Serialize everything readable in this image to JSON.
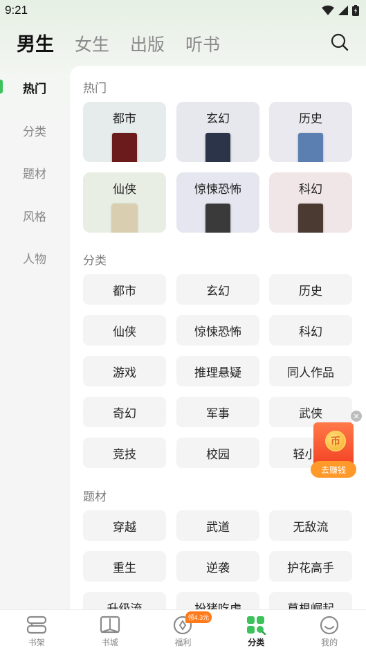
{
  "status_bar": {
    "time": "9:21"
  },
  "top_tabs": [
    {
      "label": "男生",
      "active": true
    },
    {
      "label": "女生",
      "active": false
    },
    {
      "label": "出版",
      "active": false
    },
    {
      "label": "听书",
      "active": false
    }
  ],
  "side_nav": [
    {
      "label": "热门",
      "active": true
    },
    {
      "label": "分类",
      "active": false
    },
    {
      "label": "题材",
      "active": false
    },
    {
      "label": "风格",
      "active": false
    },
    {
      "label": "人物",
      "active": false
    }
  ],
  "sections": {
    "hot": {
      "title": "热门",
      "cards": [
        {
          "label": "都市",
          "bg": "#e6ecec",
          "cover": "#6b1b1b"
        },
        {
          "label": "玄幻",
          "bg": "#e6e8ee",
          "cover": "#2b3448"
        },
        {
          "label": "历史",
          "bg": "#ebe9f0",
          "cover": "#5a7fb0"
        },
        {
          "label": "仙侠",
          "bg": "#e8eee3",
          "cover": "#d9cfb0"
        },
        {
          "label": "惊悚恐怖",
          "bg": "#e5e6f0",
          "cover": "#3a3a3a"
        },
        {
          "label": "科幻",
          "bg": "#f0e6e8",
          "cover": "#4a3a32"
        }
      ]
    },
    "category": {
      "title": "分类",
      "tags": [
        "都市",
        "玄幻",
        "历史",
        "仙侠",
        "惊悚恐怖",
        "科幻",
        "游戏",
        "推理悬疑",
        "同人作品",
        "奇幻",
        "军事",
        "武侠",
        "竞技",
        "校园",
        "轻小说"
      ]
    },
    "theme": {
      "title": "题材",
      "tags": [
        "穿越",
        "武道",
        "无敌流",
        "重生",
        "逆袭",
        "护花高手",
        "升级流",
        "扮猪吃虎",
        "草根崛起"
      ]
    }
  },
  "reward": {
    "coin": "币",
    "button": "去赚钱"
  },
  "bottom_nav": [
    {
      "label": "书架",
      "icon": "bookshelf-icon",
      "active": false
    },
    {
      "label": "书城",
      "icon": "book-store-icon",
      "active": false
    },
    {
      "label": "福利",
      "icon": "welfare-icon",
      "active": false,
      "badge": "领4.3元"
    },
    {
      "label": "分类",
      "icon": "category-icon",
      "active": true
    },
    {
      "label": "我的",
      "icon": "profile-icon",
      "active": false
    }
  ],
  "colors": {
    "accent": "#3cc25a",
    "reward": "#f23b20",
    "badge": "#ff7a1a"
  }
}
